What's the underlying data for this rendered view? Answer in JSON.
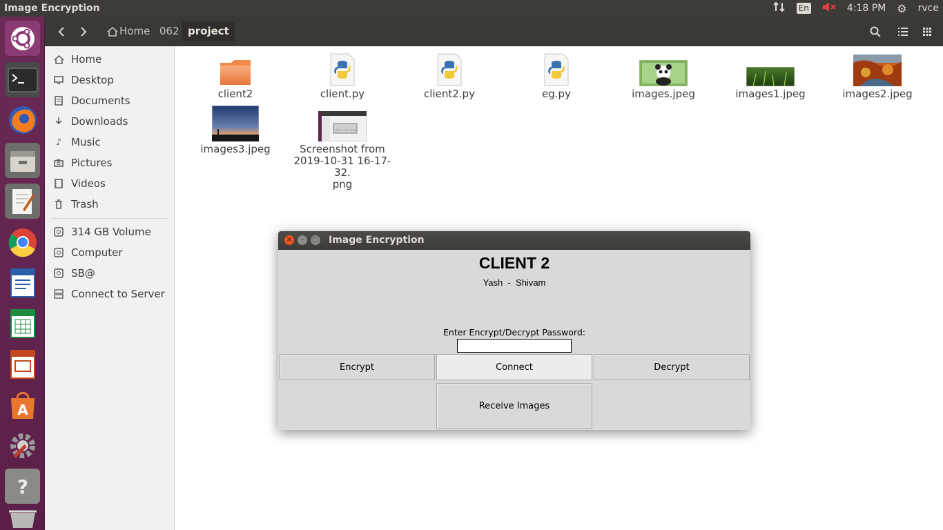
{
  "top_panel": {
    "app_title": "Image Encryption",
    "lang": "En",
    "time": "4:18 PM",
    "user": "rvce"
  },
  "launcher": {
    "items": [
      "ubuntu-dash-icon",
      "terminal-icon",
      "firefox-icon",
      "files-icon",
      "text-editor-icon",
      "chrome-icon",
      "writer-icon",
      "calc-icon",
      "impress-icon",
      "software-center-icon",
      "system-settings-icon",
      "help-icon",
      "trash-icon"
    ]
  },
  "toolbar": {
    "crumbs": [
      "Home",
      "062",
      "project"
    ]
  },
  "sidebar": {
    "items": [
      "Home",
      "Desktop",
      "Documents",
      "Downloads",
      "Music",
      "Pictures",
      "Videos",
      "Trash"
    ],
    "devices": [
      "314 GB Volume",
      "Computer",
      "SB@",
      "Connect to Server"
    ]
  },
  "files": [
    {
      "name": "client2"
    },
    {
      "name": "client.py"
    },
    {
      "name": "client2.py"
    },
    {
      "name": "eg.py"
    },
    {
      "name": "images.jpeg"
    },
    {
      "name": "images1.jpeg"
    },
    {
      "name": "images2.jpeg"
    },
    {
      "name": "images3.jpeg"
    },
    {
      "name_line1": "Screenshot from",
      "name_line2": "2019-10-31 16-17-32.",
      "name_line3": "png"
    }
  ],
  "dialog": {
    "title": "Image Encryption",
    "heading": "CLIENT 2",
    "authors": "Yash  -  Shivam",
    "password_label": "Enter Encrypt/Decrypt Password:",
    "password_value": "",
    "buttons": {
      "encrypt": "Encrypt",
      "connect": "Connect",
      "decrypt": "Decrypt",
      "receive": "Receive Images"
    }
  },
  "colors": {
    "panel": "#3c3b37",
    "launcher": "#5e2750",
    "folder": "#f08a4b",
    "tk_bg": "#d9d9d9",
    "close": "#e95420"
  }
}
